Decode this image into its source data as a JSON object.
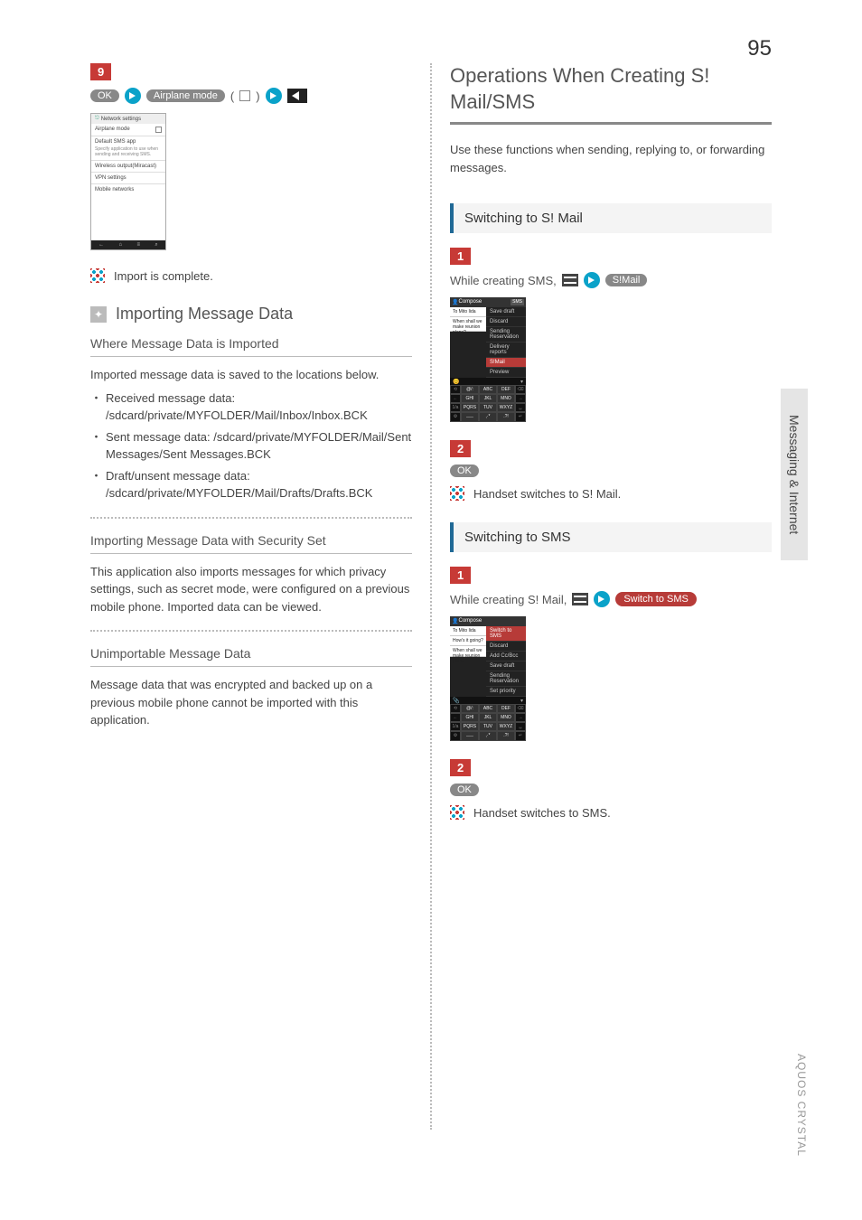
{
  "page_number": "95",
  "left": {
    "step9": {
      "num": "9",
      "action_ok": "OK",
      "action_airplane": "Airplane mode",
      "paren_open": "(",
      "paren_close": ")"
    },
    "phone": {
      "header": "Network settings",
      "items": {
        "airplane": "Airplane mode",
        "default_sms": "Default SMS app",
        "default_sms_sub": "Specify application to use when sending and receiving SMS.",
        "miracast": "Wireless output(Miracast)",
        "vpn": "VPN settings",
        "mobile": "Mobile networks"
      }
    },
    "result": "Import is complete.",
    "info_title": "Importing Message Data",
    "sub1_title": "Where Message Data is Imported",
    "sub1_text": "Imported message data is saved to the locations below.",
    "bullets": {
      "b1": "Received message data: /sdcard/private/MYFOLDER/Mail/Inbox/Inbox.BCK",
      "b2": "Sent message data: /sdcard/private/MYFOLDER/Mail/Sent Messages/Sent Messages.BCK",
      "b3": "Draft/unsent message data: /sdcard/private/MYFOLDER/Mail/Drafts/Drafts.BCK"
    },
    "sub2_title": "Importing Message Data with Security Set",
    "sub2_text": "This application also imports messages for which privacy settings, such as secret mode, were configured on a previous mobile phone. Imported data can be viewed.",
    "sub3_title": "Unimportable Message Data",
    "sub3_text": "Message data that was encrypted and backed up on a previous mobile phone cannot be imported with this application."
  },
  "right": {
    "title": "Operations When Creating S! Mail/SMS",
    "intro": "Use these functions when sending, replying to, or forwarding messages.",
    "sec1": {
      "heading": "Switching to S! Mail",
      "step1": {
        "num": "1",
        "text": "While creating SMS,",
        "pill": "S!Mail"
      },
      "shot": {
        "compose": "Compose",
        "to": "To Mito Iida",
        "body": "When shall we make reunion plans?",
        "menu": [
          "Save draft",
          "Discard",
          "Sending Reservation",
          "Delivery reports",
          "S!Mail",
          "Preview"
        ]
      },
      "step2": {
        "num": "2",
        "ok": "OK"
      },
      "result": "Handset switches to S! Mail."
    },
    "sec2": {
      "heading": "Switching to SMS",
      "step1": {
        "num": "1",
        "text": "While creating S! Mail,",
        "pill": "Switch to SMS"
      },
      "shot": {
        "compose": "Compose",
        "to": "To Mito Iida",
        "q": "How's it going?",
        "body": "When shall we make reunion plans?",
        "menu": [
          "Switch to SMS",
          "Discard",
          "Add Cc/Bcc",
          "Save draft",
          "Sending Reservation",
          "Set priority"
        ]
      },
      "step2": {
        "num": "2",
        "ok": "OK"
      },
      "result": "Handset switches to SMS."
    }
  },
  "side_tab": "Messaging & Internet",
  "footer": "AQUOS CRYSTAL"
}
